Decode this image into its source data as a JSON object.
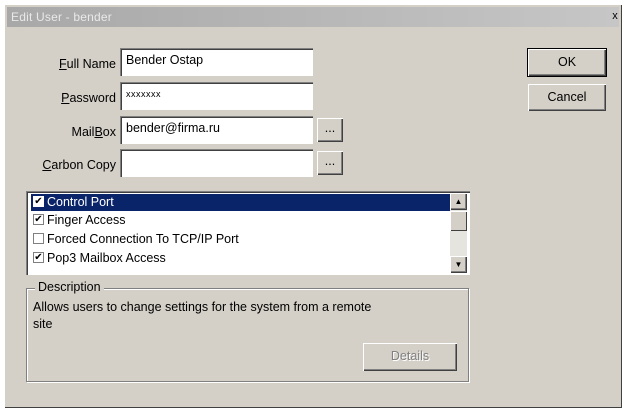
{
  "window": {
    "title": "Edit User - bender",
    "close_glyph": "x"
  },
  "form": {
    "full_name": {
      "label_underlined": "F",
      "label_rest": "ull Name",
      "value": "Bender Ostap"
    },
    "password": {
      "label_underlined": "P",
      "label_rest": "assword",
      "value": "xxxxxxx"
    },
    "mailbox": {
      "label_prefix": "Mail",
      "label_underlined": "B",
      "label_rest": "ox",
      "value": "bender@firma.ru",
      "browse": "..."
    },
    "carbon_copy": {
      "label_underlined": "C",
      "label_rest": "arbon Copy",
      "value": "",
      "browse": "..."
    }
  },
  "buttons": {
    "ok": "OK",
    "cancel": "Cancel",
    "details": "Details"
  },
  "permissions": [
    {
      "label": "Control Port",
      "checked": true,
      "selected": true
    },
    {
      "label": "Finger Access",
      "checked": true,
      "selected": false
    },
    {
      "label": "Forced Connection To TCP/IP Port",
      "checked": false,
      "selected": false
    },
    {
      "label": "Pop3 Mailbox Access",
      "checked": true,
      "selected": false
    }
  ],
  "description": {
    "legend": "Description",
    "text": "Allows users to change settings for the system from a remote site"
  }
}
